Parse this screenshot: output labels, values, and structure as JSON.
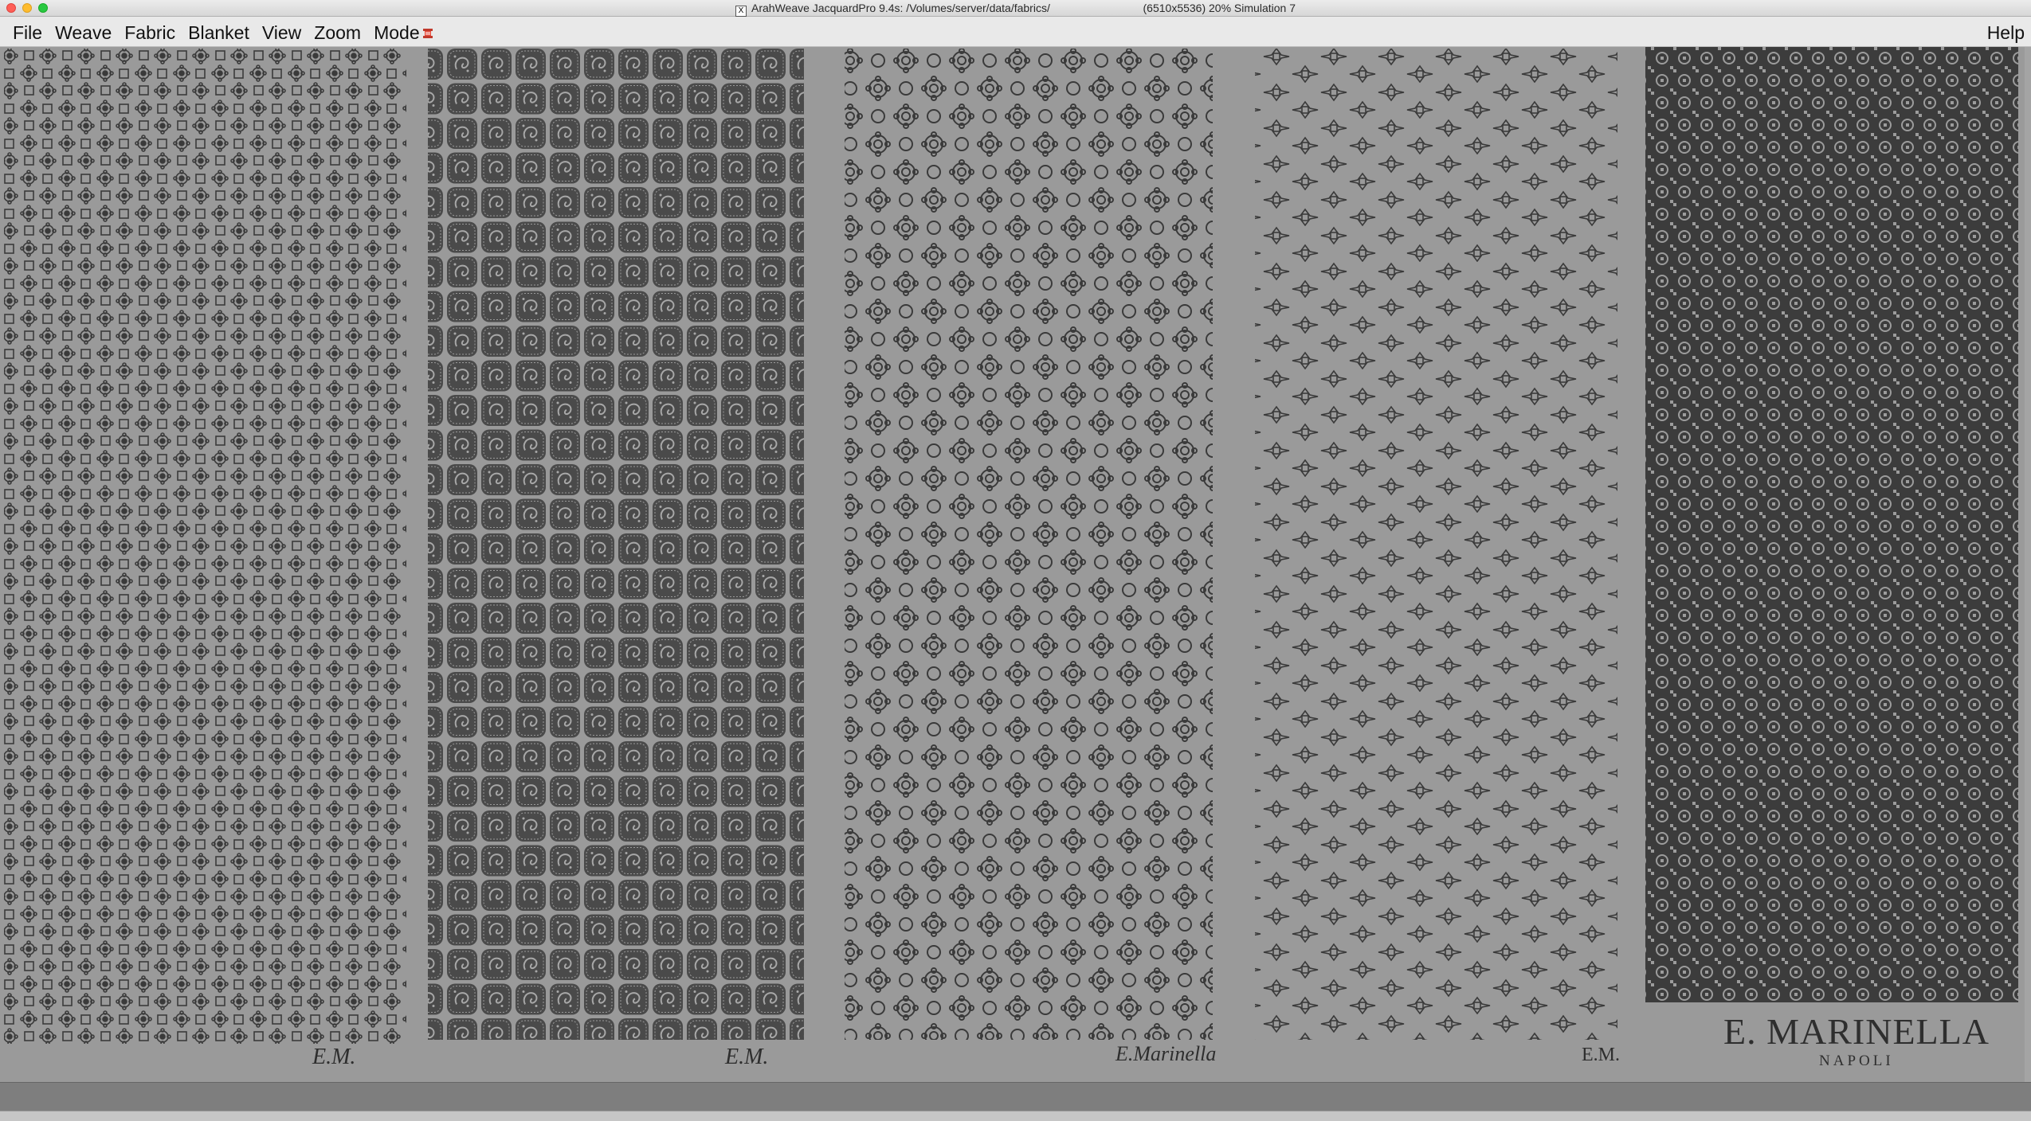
{
  "window": {
    "title": "ArahWeave JacquardPro 9.4s: /Volumes/server/data/fabrics/                              (6510x5536) 20% Simulation 7",
    "app_icon": "X"
  },
  "menu": {
    "items": [
      "File",
      "Weave",
      "Fabric",
      "Blanket",
      "View",
      "Zoom",
      "Mode"
    ],
    "help": "Help"
  },
  "panels": [
    {
      "pattern": "flowers-and-squares",
      "label": "E.M."
    },
    {
      "pattern": "paisley-tiles",
      "label": "E.M."
    },
    {
      "pattern": "rosettes",
      "label": "E.Marinella"
    },
    {
      "pattern": "crosses",
      "label": "E.M."
    },
    {
      "pattern": "dense-geometric",
      "label": "E. MARINELLA",
      "sublabel": "NAPOLI"
    }
  ],
  "colors": {
    "background": "#9a9a9a",
    "ink": "#3a3a3a",
    "menubar": "#e9e9e9"
  }
}
